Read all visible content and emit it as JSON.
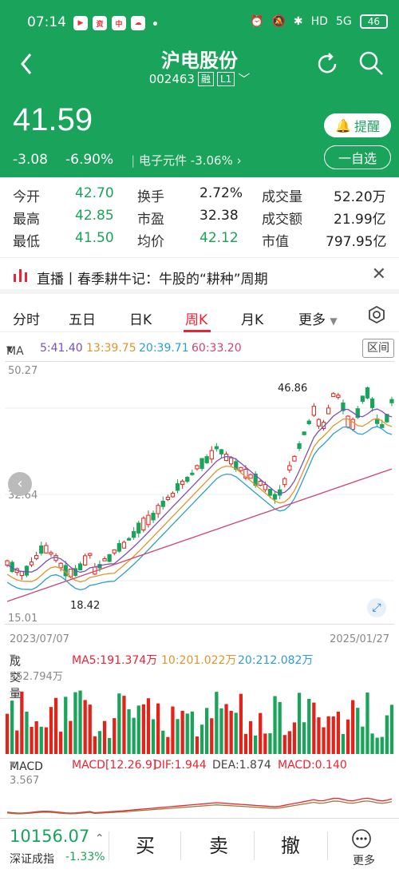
{
  "status": {
    "time": "07:14",
    "app1": "▶",
    "app2": "资",
    "app3": "中",
    "app4": "☁",
    "signal": "5G",
    "hd": "HD",
    "battery": "46"
  },
  "header": {
    "title": "沪电股份",
    "code": "002463",
    "tag1": "融",
    "tag2": "L1"
  },
  "price": {
    "last": "41.59",
    "change": "-3.08",
    "pct": "-6.90%",
    "sector": "电子元件",
    "sector_pct": "-3.06%"
  },
  "buttons": {
    "remind": "提醒",
    "watch": "一自选"
  },
  "quote": {
    "row1": [
      {
        "label": "今开",
        "value": "42.70"
      },
      {
        "label": "换手",
        "value": "2.72%"
      },
      {
        "label": "成交量",
        "value": "52.20万"
      }
    ],
    "row2": [
      {
        "label": "最高",
        "value": "42.85"
      },
      {
        "label": "市盈",
        "value": "32.38"
      },
      {
        "label": "成交额",
        "value": "21.99亿"
      }
    ],
    "row3": [
      {
        "label": "最低",
        "value": "41.50"
      },
      {
        "label": "均价",
        "value": "42.12"
      },
      {
        "label": "市值",
        "value": "797.95亿"
      }
    ]
  },
  "news": {
    "text": "直播丨春季耕牛记：牛股的“耕种”周期"
  },
  "tabs": [
    "分时",
    "五日",
    "日K",
    "周K",
    "月K",
    "更多"
  ],
  "ma": {
    "label": "MA",
    "ma5": "5:41.40",
    "ma13": "13:39.75",
    "ma20": "20:39.71",
    "ma60": "60:33.20",
    "interval": "区间"
  },
  "kchart": {
    "ymax": "50.27",
    "ymid": "32.64",
    "ymin": "15.01",
    "high_label": "46.86",
    "low_label": "18.42",
    "date_start": "2023/07/07",
    "date_end": "2025/01/27"
  },
  "volume": {
    "label": "成交量",
    "ma5": "MA5:191.374万",
    "ma10": "10:201.022万",
    "ma20": "20:212.082万",
    "max": "552.794万"
  },
  "macd": {
    "label": "MACD",
    "params": "MACD[12.26.9]",
    "dif": "DIF:1.944",
    "dea": "DEA:1.874",
    "macd": "MACD:0.140",
    "top": "3.567"
  },
  "bottom": {
    "index_value": "10156.07",
    "index_name": "深证成指",
    "index_change": "-1.33%",
    "buy": "买",
    "sell": "卖",
    "cancel": "撤",
    "more": "更多"
  },
  "colors": {
    "up": "#e2231a",
    "down": "#1aa35a",
    "accent": "#1aa35a"
  }
}
